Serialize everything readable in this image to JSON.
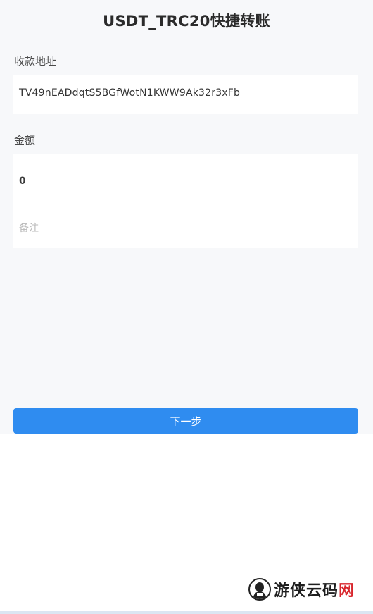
{
  "header": {
    "title": "USDT_TRC20快捷转账"
  },
  "address": {
    "label": "收款地址",
    "value": "TV49nEADdqtS5BGfWotN1KWW9Ak32r3xFb"
  },
  "amount": {
    "label": "金额",
    "value": "0",
    "remark_placeholder": "备注"
  },
  "actions": {
    "next_label": "下一步"
  },
  "colors": {
    "page_background": "#f7f8fa",
    "card_background": "#ffffff",
    "button": "#2f8cf0"
  },
  "watermark": {
    "text": "游侠云码",
    "accent": "网"
  }
}
